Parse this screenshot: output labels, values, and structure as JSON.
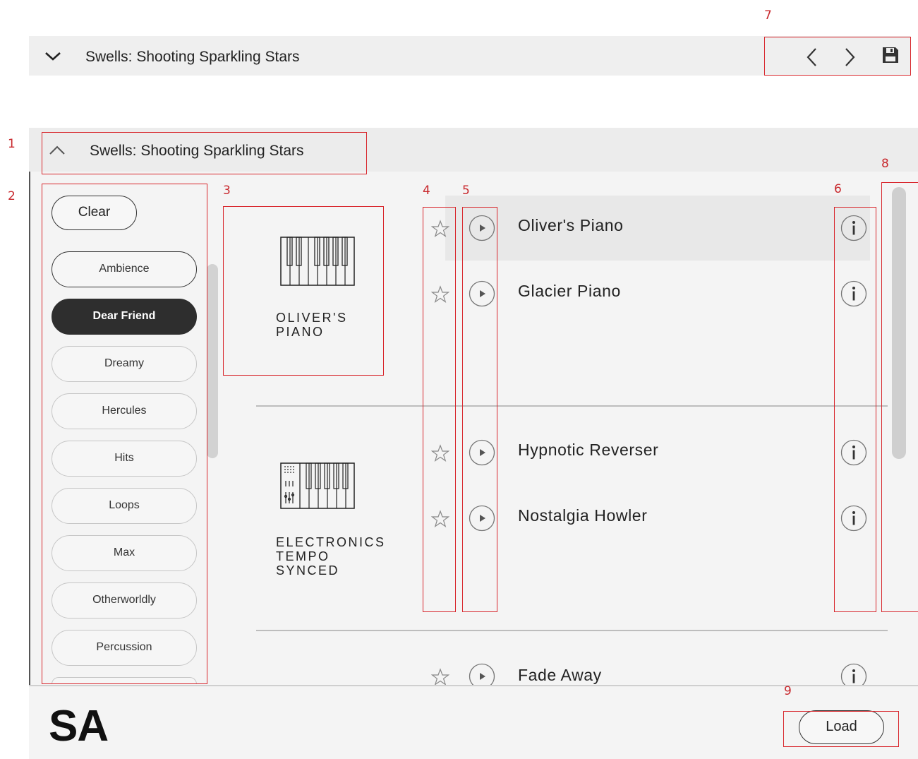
{
  "top_bar": {
    "title": "Swells: Shooting Sparkling Stars"
  },
  "panel": {
    "title": "Swells: Shooting Sparkling Stars",
    "clear_label": "Clear",
    "tags": [
      "Ambience",
      "Dear Friend",
      "Dreamy",
      "Hercules",
      "Hits",
      "Loops",
      "Max",
      "Otherworldly",
      "Percussion"
    ],
    "selected_tag": "Dear Friend"
  },
  "instruments": [
    {
      "label_lines": [
        "OLIVER'S",
        "PIANO"
      ],
      "icon": "piano-keys-icon",
      "presets": [
        "Oliver's Piano",
        "Glacier Piano"
      ]
    },
    {
      "label_lines": [
        "ELECTRONICS",
        "TEMPO",
        "SYNCED"
      ],
      "icon": "electronics-synth-icon",
      "presets": [
        "Hypnotic Reverser",
        "Nostalgia Howler"
      ]
    },
    {
      "presets": [
        "Fade Away"
      ]
    }
  ],
  "footer": {
    "logo": "SA",
    "load_label": "Load"
  },
  "callouts": [
    "1",
    "2",
    "3",
    "4",
    "5",
    "6",
    "7",
    "8",
    "9"
  ],
  "icons": [
    "chevron-down-icon",
    "chevron-up-icon",
    "chevron-left-icon",
    "chevron-right-icon",
    "save-icon",
    "star-icon",
    "play-icon",
    "info-icon"
  ],
  "colors": {
    "annotation_red": "#d8262c",
    "selected_tag_bg": "#2e2e2e",
    "panel_bg": "#f4f4f4"
  }
}
